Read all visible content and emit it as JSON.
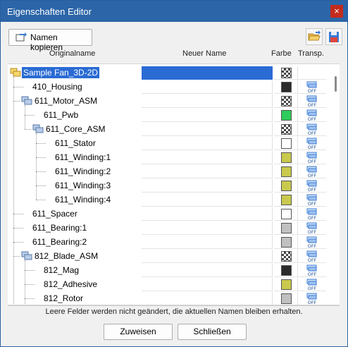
{
  "window": {
    "title": "Eigenschaften Editor",
    "close_glyph": "×"
  },
  "toolbar": {
    "copy_names_label": "Namen kopieren",
    "copy_icon": "copy-names-icon",
    "open_icon": "folder-open-icon",
    "save_icon": "save-icon"
  },
  "columns": {
    "original": "Originalname",
    "new": "Neuer Name",
    "color": "Farbe",
    "transp": "Transp."
  },
  "rows": [
    {
      "name": "Sample Fan_3D-2D",
      "level": 0,
      "icon": "assembly-root-icon",
      "color": "checker",
      "transp": "",
      "selected": true
    },
    {
      "name": "410_Housing",
      "level": 1,
      "icon": "",
      "color": "#2b2b2b",
      "transp": "OFF"
    },
    {
      "name": "611_Motor_ASM",
      "level": 1,
      "icon": "assembly-icon",
      "color": "checker",
      "transp": "OFF"
    },
    {
      "name": "611_Pwb",
      "level": 2,
      "icon": "",
      "color": "#2ecc5a",
      "transp": "OFF"
    },
    {
      "name": "611_Core_ASM",
      "level": 2,
      "icon": "assembly-icon",
      "color": "checker",
      "transp": "OFF"
    },
    {
      "name": "611_Stator",
      "level": 3,
      "icon": "",
      "color": "#ffffff",
      "transp": "OFF"
    },
    {
      "name": "611_Winding:1",
      "level": 3,
      "icon": "",
      "color": "#c9c94e",
      "transp": "OFF"
    },
    {
      "name": "611_Winding:2",
      "level": 3,
      "icon": "",
      "color": "#c9c94e",
      "transp": "OFF"
    },
    {
      "name": "611_Winding:3",
      "level": 3,
      "icon": "",
      "color": "#c9c94e",
      "transp": "OFF"
    },
    {
      "name": "611_Winding:4",
      "level": 3,
      "icon": "",
      "color": "#c9c94e",
      "transp": "OFF"
    },
    {
      "name": "611_Spacer",
      "level": 1,
      "icon": "",
      "color": "#ffffff",
      "transp": "OFF"
    },
    {
      "name": "611_Bearing:1",
      "level": 1,
      "icon": "",
      "color": "#c0c0c0",
      "transp": "OFF"
    },
    {
      "name": "611_Bearing:2",
      "level": 1,
      "icon": "",
      "color": "#c0c0c0",
      "transp": "OFF"
    },
    {
      "name": "812_Blade_ASM",
      "level": 1,
      "icon": "assembly-icon",
      "color": "checker",
      "transp": "OFF"
    },
    {
      "name": "812_Mag",
      "level": 2,
      "icon": "",
      "color": "#2b2b2b",
      "transp": "OFF"
    },
    {
      "name": "812_Adhesive",
      "level": 2,
      "icon": "",
      "color": "#c9c94e",
      "transp": "OFF"
    },
    {
      "name": "812_Rotor",
      "level": 2,
      "icon": "",
      "color": "#c0c0c0",
      "transp": "OFF"
    }
  ],
  "footer": {
    "note": "Leere Felder werden nicht geändert, die aktuellen Namen bleiben erhalten.",
    "assign_label": "Zuweisen",
    "close_label": "Schließen"
  }
}
